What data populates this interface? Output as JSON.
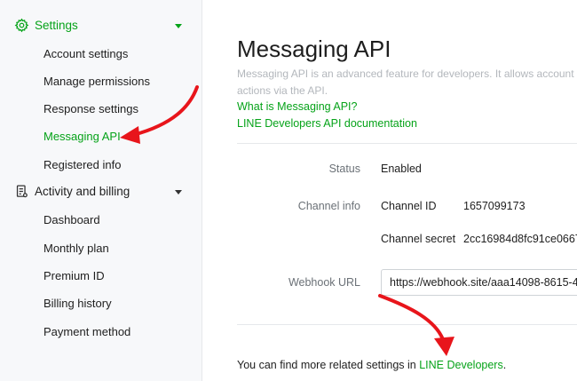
{
  "sidebar": {
    "settings": {
      "label": "Settings",
      "icon": "gear-icon",
      "items": [
        {
          "label": "Account settings"
        },
        {
          "label": "Manage permissions"
        },
        {
          "label": "Response settings"
        },
        {
          "label": "Messaging API",
          "active": true
        },
        {
          "label": "Registered info"
        }
      ]
    },
    "billing": {
      "label": "Activity and billing",
      "icon": "document-icon",
      "items": [
        {
          "label": "Dashboard"
        },
        {
          "label": "Monthly plan"
        },
        {
          "label": "Premium ID"
        },
        {
          "label": "Billing history"
        },
        {
          "label": "Payment method"
        }
      ]
    }
  },
  "main": {
    "title": "Messaging API",
    "description_line1": "Messaging API is an advanced feature for developers. It allows account",
    "description_line2": "actions via the API.",
    "link_what_is": "What is Messaging API?",
    "link_docs": "LINE Developers API documentation",
    "status": {
      "label": "Status",
      "value": "Enabled"
    },
    "channel_info": {
      "label": "Channel info",
      "channel_id_label": "Channel ID",
      "channel_id_value": "1657099173",
      "channel_secret_label": "Channel secret",
      "channel_secret_value": "2cc16984d8fc91ce0667"
    },
    "webhook": {
      "label": "Webhook URL",
      "value": "https://webhook.site/aaa14098-8615-4"
    },
    "footer": {
      "text": "You can find more related settings in ",
      "link": "LINE Developers",
      "suffix": "."
    }
  },
  "colors": {
    "accent": "#06a319",
    "arrow": "#e8151b",
    "sidebar_bg": "#f7f8fa"
  }
}
